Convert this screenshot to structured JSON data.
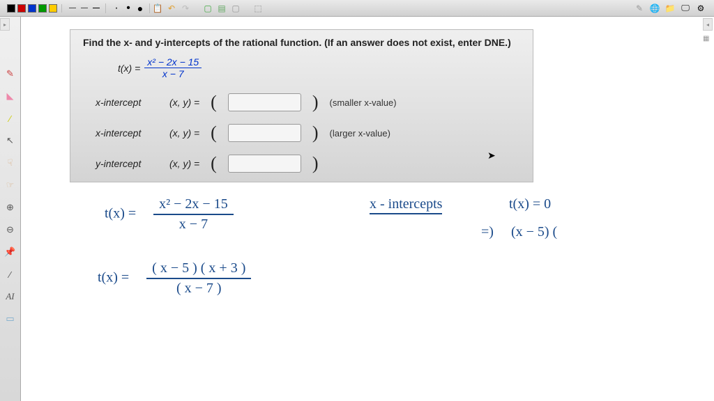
{
  "toolbar": {
    "colors": [
      "#000000",
      "#cc0000",
      "#0033cc",
      "#009900",
      "#ffcc00"
    ],
    "icons": {
      "calendar": "📋",
      "undo": "↶",
      "redo": "↷",
      "page_green": "▢",
      "page_ruled": "▤",
      "page_blank": "▢",
      "shapes": "⬚"
    },
    "right": {
      "globe": "🌐",
      "folder": "📁",
      "screen": "🖵",
      "gear": "⚙"
    }
  },
  "left_tools": {
    "pencil": "✎",
    "eraser": "◣",
    "highlighter": "⁄",
    "arrow": "↖",
    "hand1": "☟",
    "hand2": "☞",
    "zoom_in": "⊕",
    "zoom_out": "⊖",
    "pin": "📌",
    "line": "⁄",
    "text": "AI",
    "ruler": "▭"
  },
  "problem": {
    "title": "Find the x- and y-intercepts of the rational function. (If an answer does not exist, enter DNE.)",
    "func_lhs": "t(x) =",
    "frac_top": "x² − 2x − 15",
    "frac_bot": "x − 7",
    "rows": [
      {
        "label": "x-intercept",
        "xy": "(x, y) =",
        "hint": "(smaller x-value)"
      },
      {
        "label": "x-intercept",
        "xy": "(x, y) =",
        "hint": "(larger x-value)"
      },
      {
        "label": "y-intercept",
        "xy": "(x, y) =",
        "hint": ""
      }
    ]
  },
  "handwriting": {
    "line1_lhs": "t(x) =",
    "line1_top": "x² − 2x − 15",
    "line1_bot": "x − 7",
    "line2_lhs": "t(x)  =",
    "line2_top": "( x − 5 ) ( x + 3 )",
    "line2_bot": "( x − 7 )",
    "xint_label": "x - intercepts",
    "tx0": "t(x) = 0",
    "implies": "=)",
    "factor": "(x − 5) ("
  }
}
